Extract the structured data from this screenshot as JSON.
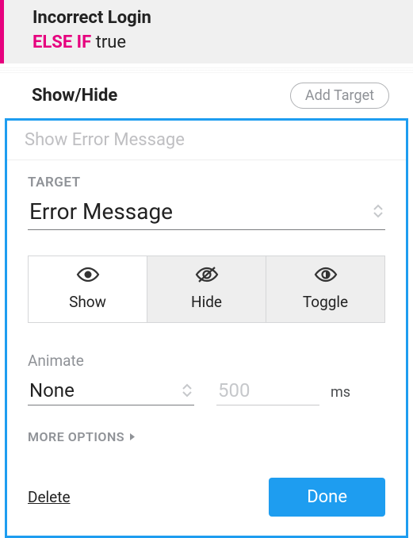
{
  "condition": {
    "title": "Incorrect Login",
    "keyword": "ELSE IF",
    "expression": "true"
  },
  "action": {
    "title": "Show/Hide",
    "add_target_label": "Add Target"
  },
  "panel": {
    "title": "Show Error Message",
    "target_label": "TARGET",
    "target_value": "Error Message",
    "modes": {
      "show": "Show",
      "hide": "Hide",
      "toggle": "Toggle"
    },
    "animate_label": "Animate",
    "animate_value": "None",
    "duration_placeholder": "500",
    "duration_unit": "ms",
    "more_options_label": "MORE OPTIONS",
    "delete_label": "Delete",
    "done_label": "Done"
  }
}
